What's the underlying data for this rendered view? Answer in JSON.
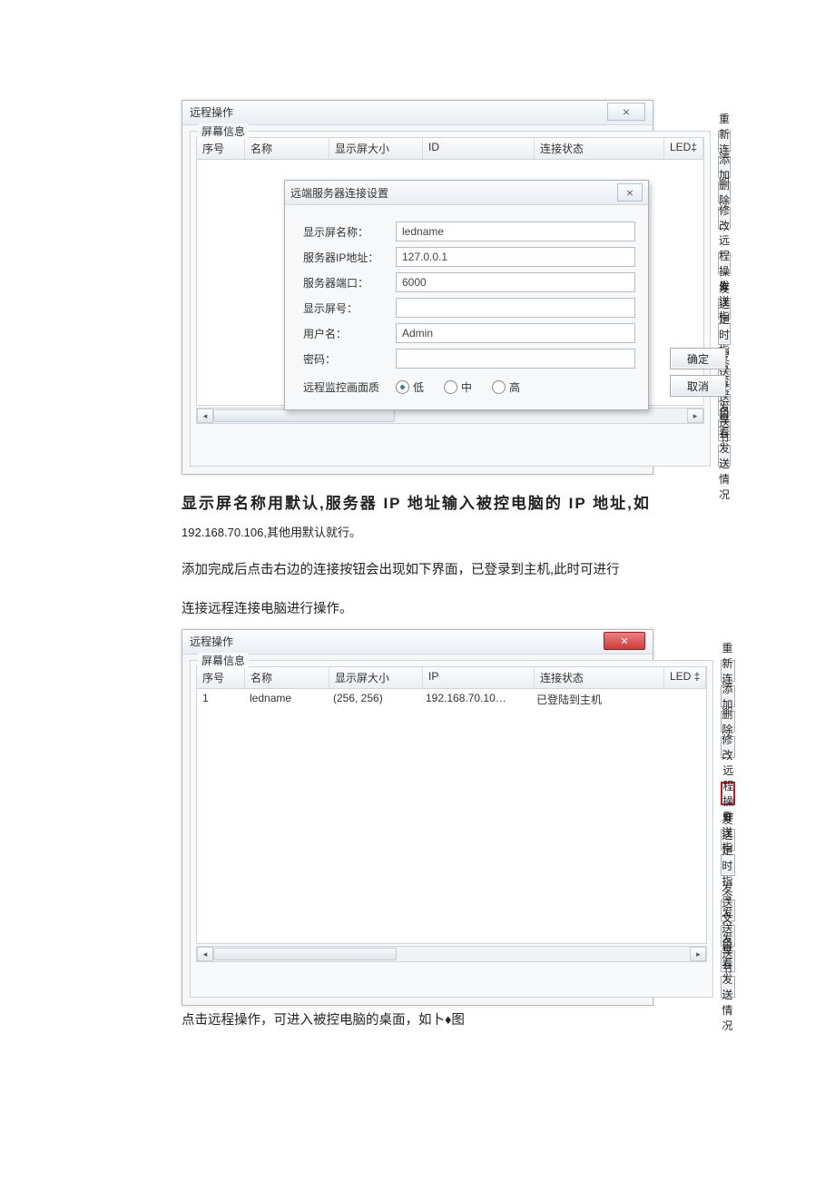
{
  "screenshot1": {
    "window_title": "远程操作",
    "close_glyph": "⨯",
    "fieldset_title": "屏幕信息",
    "columns": {
      "c1": "序号",
      "c2": "名称",
      "c3": "显示屏大小",
      "c4": "ID",
      "c5": "连接状态",
      "c6": "LED‡"
    },
    "modal": {
      "title": "远端服务器连接设置",
      "close_glyph": "⨯",
      "labels": {
        "name": "显示屏名称：",
        "ip": "服务器IP地址：",
        "port": "服务器端口：",
        "screen_no": "显示屏号：",
        "user": "用户名：",
        "pwd": "密码：",
        "quality": "远程监控画面质"
      },
      "values": {
        "name": "ledname",
        "ip": "127.0.0.1",
        "port": "6000",
        "screen_no": "",
        "user": "Admin",
        "pwd": ""
      },
      "quality_options": {
        "low": "低",
        "mid": "中",
        "high": "高"
      },
      "ok": "确定",
      "cancel": "取消"
    },
    "side_buttons": {
      "reconnect": "重新连接",
      "add": "添加",
      "delete": "删除",
      "modify": "修改",
      "remote_op": "远程操作",
      "send_cmd": "发送指令",
      "send_sched": "发送定时指令表",
      "send_file": "发送文件",
      "send_dir": "发送目录",
      "send_prog": "发送节目",
      "view_send": "查看发送情况"
    }
  },
  "para1_big": "显示屏名称用默认,服务器 IP 地址输入被控电脑的 IP 地址,如",
  "para1_small": "192.168.70.106,其他用默认就行。",
  "para2": "添加完成后点击右边的连接按钮会出现如下界面，已登录到主机,此时可进行",
  "para3": "连接远程连接电脑进行操作。",
  "screenshot2": {
    "window_title": "远程操作",
    "fieldset_title": "屏幕信息",
    "columns": {
      "c1": "序号",
      "c2": "名称",
      "c3": "显示屏大小",
      "c4": "IP",
      "c5": "连接状态",
      "c6": "LED ‡"
    },
    "row": {
      "c1": "1",
      "c2": "ledname",
      "c3": "(256, 256)",
      "c4": "192.168.70.10…",
      "c5": "已登陆到主机",
      "c6": ""
    },
    "side_buttons": {
      "reconnect": "重新连接",
      "add": "添加",
      "delete": "删除",
      "modify": "修改",
      "remote_op": "远程操作",
      "send_cmd": "发送指令",
      "send_sched": "发送定时指令表",
      "send_file": "发送文件",
      "send_dir": "发送目录",
      "send_prog": "发送节目",
      "view_send": "查看发送情况"
    }
  },
  "para4": "点击远程操作，可进入被控电脑的桌面，如卜♦图"
}
